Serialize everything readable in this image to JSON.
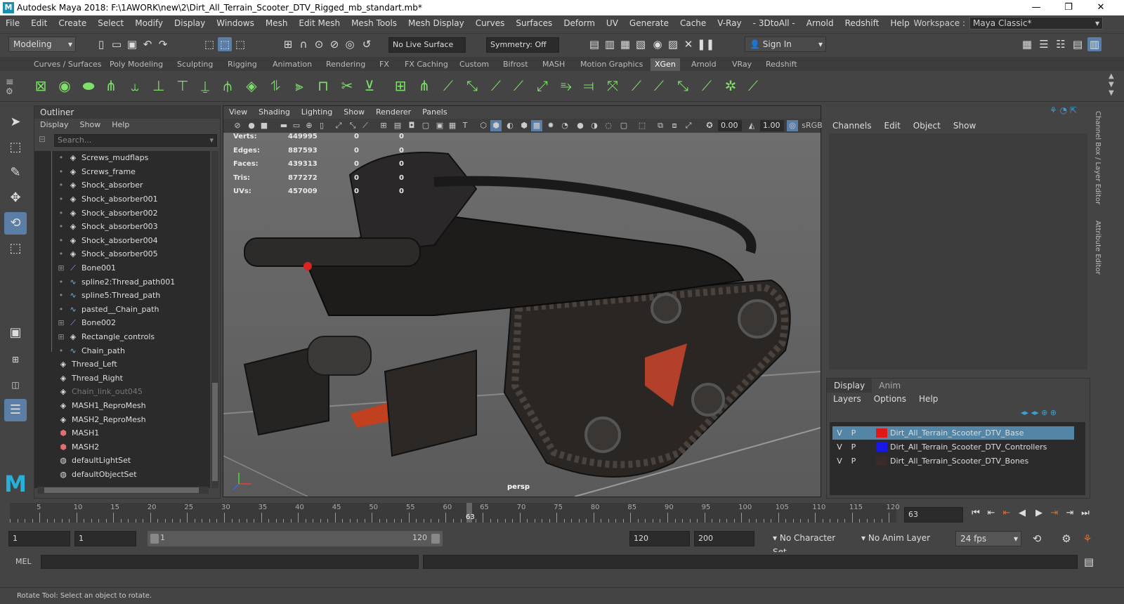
{
  "window": {
    "title": "Autodesk Maya 2018: F:\\1AWORK\\new\\2\\Dirt_All_Terrain_Scooter_DTV_Rigged_mb_standart.mb*",
    "minimize": "—",
    "maximize": "❐",
    "close": "✕"
  },
  "menubar": [
    "File",
    "Edit",
    "Create",
    "Select",
    "Modify",
    "Display",
    "Windows",
    "Mesh",
    "Edit Mesh",
    "Mesh Tools",
    "Mesh Display",
    "Curves",
    "Surfaces",
    "Deform",
    "UV",
    "Generate",
    "Cache",
    "V-Ray",
    "- 3DtoAll -",
    "Arnold",
    "Redshift",
    "Help"
  ],
  "workspace": {
    "label": "Workspace :",
    "value": "Maya Classic*"
  },
  "statusline": {
    "mode": "Modeling",
    "live_surface": "No Live Surface",
    "symmetry": "Symmetry: Off",
    "sign_in": "Sign In"
  },
  "shelf_tabs": [
    "Curves / Surfaces",
    "Poly Modeling",
    "Sculpting",
    "Rigging",
    "Animation",
    "Rendering",
    "FX",
    "FX Caching",
    "Custom",
    "Bifrost",
    "MASH",
    "Motion Graphics",
    "XGen",
    "Arnold",
    "VRay",
    "Redshift"
  ],
  "active_shelf_tab": "XGen",
  "outliner": {
    "title": "Outliner",
    "menu": [
      "Display",
      "Show",
      "Help"
    ],
    "search_placeholder": "Search...",
    "items": [
      {
        "label": "Screws_mudflaps",
        "icon": "mesh-icon",
        "dim": false
      },
      {
        "label": "Screws_frame",
        "icon": "mesh-icon",
        "dim": false
      },
      {
        "label": "Shock_absorber",
        "icon": "mesh-icon",
        "dim": false
      },
      {
        "label": "Shock_absorber001",
        "icon": "mesh-icon",
        "dim": false
      },
      {
        "label": "Shock_absorber002",
        "icon": "mesh-icon",
        "dim": false
      },
      {
        "label": "Shock_absorber003",
        "icon": "mesh-icon",
        "dim": false
      },
      {
        "label": "Shock_absorber004",
        "icon": "mesh-icon",
        "dim": false
      },
      {
        "label": "Shock_absorber005",
        "icon": "mesh-icon",
        "dim": false
      },
      {
        "label": "Bone001",
        "icon": "joint-icon",
        "dim": false
      },
      {
        "label": "spline2:Thread_path001",
        "icon": "curve-icon",
        "dim": false
      },
      {
        "label": "spline5:Thread_path",
        "icon": "curve-icon",
        "dim": false
      },
      {
        "label": "pasted__Chain_path",
        "icon": "curve-icon",
        "dim": false
      },
      {
        "label": "Bone002",
        "icon": "joint-icon",
        "dim": false
      },
      {
        "label": "Rectangle_controls",
        "icon": "mesh-icon",
        "dim": false
      },
      {
        "label": "Chain_path",
        "icon": "curve-icon",
        "dim": false
      },
      {
        "label": "Thread_Left",
        "icon": "mesh-icon",
        "dim": false
      },
      {
        "label": "Thread_Right",
        "icon": "mesh-icon",
        "dim": false
      },
      {
        "label": "Chain_link_out045",
        "icon": "mesh-icon",
        "dim": true
      },
      {
        "label": "MASH1_ReproMesh",
        "icon": "mesh-icon",
        "dim": false
      },
      {
        "label": "MASH2_ReproMesh",
        "icon": "mesh-icon",
        "dim": false
      },
      {
        "label": "MASH1",
        "icon": "mash-icon",
        "dim": false
      },
      {
        "label": "MASH2",
        "icon": "mash-icon",
        "dim": false
      },
      {
        "label": "defaultLightSet",
        "icon": "set-icon",
        "dim": false
      },
      {
        "label": "defaultObjectSet",
        "icon": "set-icon",
        "dim": false
      }
    ]
  },
  "viewport": {
    "menu": [
      "View",
      "Shading",
      "Lighting",
      "Show",
      "Renderer",
      "Panels"
    ],
    "near_clip": "0.00",
    "far_clip": "1.00",
    "color_space": "sRGB",
    "camera": "persp",
    "hud": [
      {
        "label": "Verts:",
        "v1": "449995",
        "v2": "0",
        "v3": "0"
      },
      {
        "label": "Edges:",
        "v1": "887593",
        "v2": "0",
        "v3": "0"
      },
      {
        "label": "Faces:",
        "v1": "439313",
        "v2": "0",
        "v3": "0"
      },
      {
        "label": "Tris:",
        "v1": "877272",
        "v2": "0",
        "v3": "0"
      },
      {
        "label": "UVs:",
        "v1": "457009",
        "v2": "0",
        "v3": "0"
      }
    ]
  },
  "channelbox": {
    "menu": [
      "Channels",
      "Edit",
      "Object",
      "Show"
    ],
    "side_tab_1": "Channel Box / Layer Editor",
    "side_tab_2": "Attribute Editor"
  },
  "layer_editor": {
    "tabs": [
      "Display",
      "Anim"
    ],
    "menu": [
      "Layers",
      "Options",
      "Help"
    ],
    "layers": [
      {
        "v": "V",
        "p": "P",
        "color": "#e01818",
        "name": "Dirt_All_Terrain_Scooter_DTV_Base",
        "selected": true
      },
      {
        "v": "V",
        "p": "P",
        "color": "#1818e8",
        "name": "Dirt_All_Terrain_Scooter_DTV_Controllers",
        "selected": false
      },
      {
        "v": "V",
        "p": "P",
        "color": "#3a2a2a",
        "name": "Dirt_All_Terrain_Scooter_DTV_Bones",
        "selected": false
      }
    ]
  },
  "timeline": {
    "labels": [
      "5",
      "10",
      "15",
      "20",
      "25",
      "30",
      "35",
      "40",
      "45",
      "50",
      "55",
      "60",
      "65",
      "70",
      "75",
      "80",
      "85",
      "90",
      "95",
      "100",
      "105",
      "110",
      "115",
      "120"
    ],
    "current_frame": "63",
    "current_frame_field": "63"
  },
  "range": {
    "start": "1",
    "playback_start": "1",
    "slider_start": "1",
    "slider_end": "120",
    "playback_end": "120",
    "end": "200",
    "character_set": "No Character Set",
    "anim_layer": "No Anim Layer",
    "fps": "24 fps"
  },
  "command": {
    "label": "MEL"
  },
  "status": "Rotate Tool: Select an object to rotate.",
  "colors": {
    "accent": "#5285a6",
    "shelf_green": "#7ee06a",
    "maya_logo": "#27b0d9"
  }
}
